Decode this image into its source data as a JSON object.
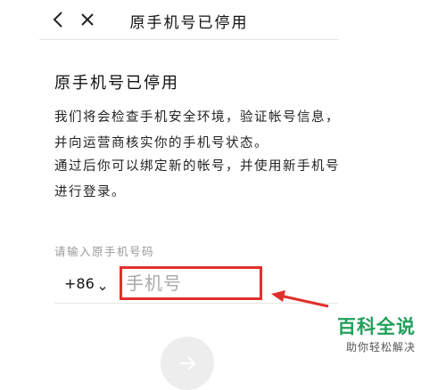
{
  "header": {
    "title": "原手机号已停用",
    "back_icon": "chevron-left-icon",
    "close_icon": "close-icon"
  },
  "main": {
    "heading": "原手机号已停用",
    "paragraph1": "我们将会检查手机安全环境，验证帐号信息，并向运营商核实你的手机号状态。",
    "paragraph2": "通过后你可以绑定新的帐号，并使用新手机号进行登录。"
  },
  "form": {
    "label": "请输入原手机号码",
    "country_code": "+86",
    "phone_placeholder": "手机号",
    "phone_value": ""
  },
  "next_button": {
    "icon": "arrow-right-icon"
  },
  "watermark": {
    "title": "百科全说",
    "subtitle": "助你轻松解决"
  },
  "colors": {
    "annotation_red": "#e0302b",
    "watermark_green": "#22a05a",
    "muted_text": "#999999"
  }
}
